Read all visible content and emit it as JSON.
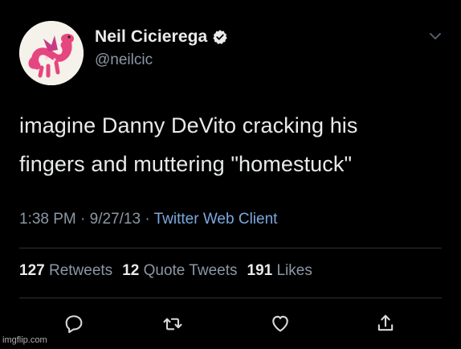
{
  "author": {
    "display_name": "Neil Cicierega",
    "handle": "@neilcic",
    "verified": true
  },
  "tweet": {
    "lines": [
      "imagine Danny DeVito cracking his",
      "fingers and muttering \"homestuck\""
    ]
  },
  "meta": {
    "time": "1:38 PM",
    "separator": "·",
    "date": "9/27/13",
    "client": "Twitter Web Client"
  },
  "stats": {
    "retweets_count": "127",
    "retweets_label": "Retweets",
    "quotes_count": "12",
    "quotes_label": "Quote Tweets",
    "likes_count": "191",
    "likes_label": "Likes"
  },
  "actions": [
    "reply-icon",
    "retweet-icon",
    "like-icon",
    "share-icon"
  ],
  "watermark": "imgflip.com",
  "colors": {
    "background": "#000000",
    "text": "#e9eaeb",
    "muted": "#8b98a5",
    "link": "#7aa9e0",
    "verified": "#e9eaeb",
    "divider": "#2c3137"
  }
}
